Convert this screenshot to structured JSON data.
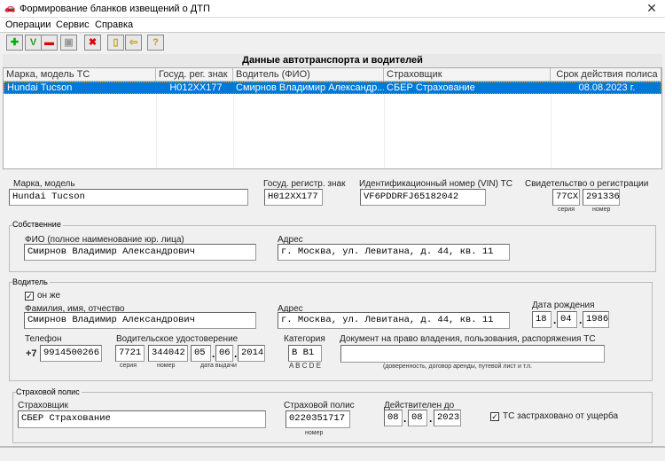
{
  "window": {
    "title": "Формирование бланков извещений о ДТП",
    "close": "✕",
    "icon": "car-icon"
  },
  "menu": [
    "Операции",
    "Сервис",
    "Справка"
  ],
  "toolbar": [
    {
      "name": "add",
      "glyph": "✚",
      "color": "#00b000"
    },
    {
      "name": "edit",
      "glyph": "V",
      "color": "#20a020"
    },
    {
      "name": "remove",
      "glyph": "▬",
      "color": "#e00000"
    },
    {
      "name": "save",
      "glyph": "▣",
      "color": "#999999"
    },
    {
      "name": "delete",
      "glyph": "✖",
      "color": "#e00000"
    },
    {
      "name": "clipboard",
      "glyph": "▯",
      "color": "#c0a000"
    },
    {
      "name": "paste",
      "glyph": "⇦",
      "color": "#c0a000"
    },
    {
      "name": "help",
      "glyph": "?",
      "color": "#c0a000"
    }
  ],
  "grid": {
    "title": "Данные автотранспорта и водителей",
    "columns": [
      "Марка, модель ТС",
      "Госуд. рег. знак",
      "Водитель (ФИО)",
      "Страховщик",
      "Срок действия полиса"
    ],
    "rows": [
      [
        "Hundai Tucson",
        "H012XX177",
        "Смирнов Владимир Александр...",
        "СБЕР Страхование",
        "08.08.2023 г."
      ]
    ]
  },
  "vehicle": {
    "model_label": "Марка, модель",
    "model": "Hundai Tucson",
    "plate_label": "Госуд. регистр. знак",
    "plate": "H012XX177",
    "vin_label": "Идентификационный номер (VIN) ТС",
    "vin": "VF6PDDRFJ65182042",
    "reg_label": "Свидетельство о регистрации",
    "reg_series": "77CX",
    "reg_number": "291336",
    "series_sub": "серия",
    "number_sub": "номер"
  },
  "owner": {
    "group": "Собственние",
    "name_label": "ФИО (полное наименование юр. лица)",
    "name": "Смирнов Владимир Александрович",
    "addr_label": "Адрес",
    "addr": "г. Москва, ул. Левитана, д. 44, кв. 11"
  },
  "driver": {
    "group": "Водитель",
    "same_label": "он же",
    "same_checked": true,
    "name_label": "Фамилия, имя, отчество",
    "name": "Смирнов Владимир Александрович",
    "addr_label": "Адрес",
    "addr": "г. Москва, ул. Левитана, д. 44, кв. 11",
    "dob_label": "Дата рождения",
    "dob_d": "18",
    "dob_m": "04",
    "dob_y": "1986",
    "phone_label": "Телефон",
    "phone_prefix": "+7",
    "phone": "9914500266",
    "lic_label": "Водительское удостоверение",
    "lic_series": "7721",
    "lic_number": "344042",
    "lic_d": "05",
    "lic_m": "06",
    "lic_y": "2014",
    "lic_series_sub": "серия",
    "lic_number_sub": "номер",
    "lic_date_sub": "дата выдачи",
    "cat_label": "Категория",
    "cat": "B B1",
    "cat_sub": "A B C D E",
    "doc_label": "Документ на право владения, пользования, распоряжения ТС",
    "doc": "",
    "doc_sub": "(доверенность, договор аренды, путевой лист и т.п."
  },
  "policy": {
    "group": "Страховой полис",
    "insurer_label": "Страховщик",
    "insurer": "СБЕР Страхование",
    "policy_label": "Страховой полис",
    "policy": "0220351717",
    "policy_sub": "номер",
    "valid_label": "Действителен до",
    "valid_d": "08",
    "valid_m": "08",
    "valid_y": "2023",
    "damage_label": "ТС застраховано от ущерба",
    "damage_checked": true
  },
  "date_sep": "."
}
